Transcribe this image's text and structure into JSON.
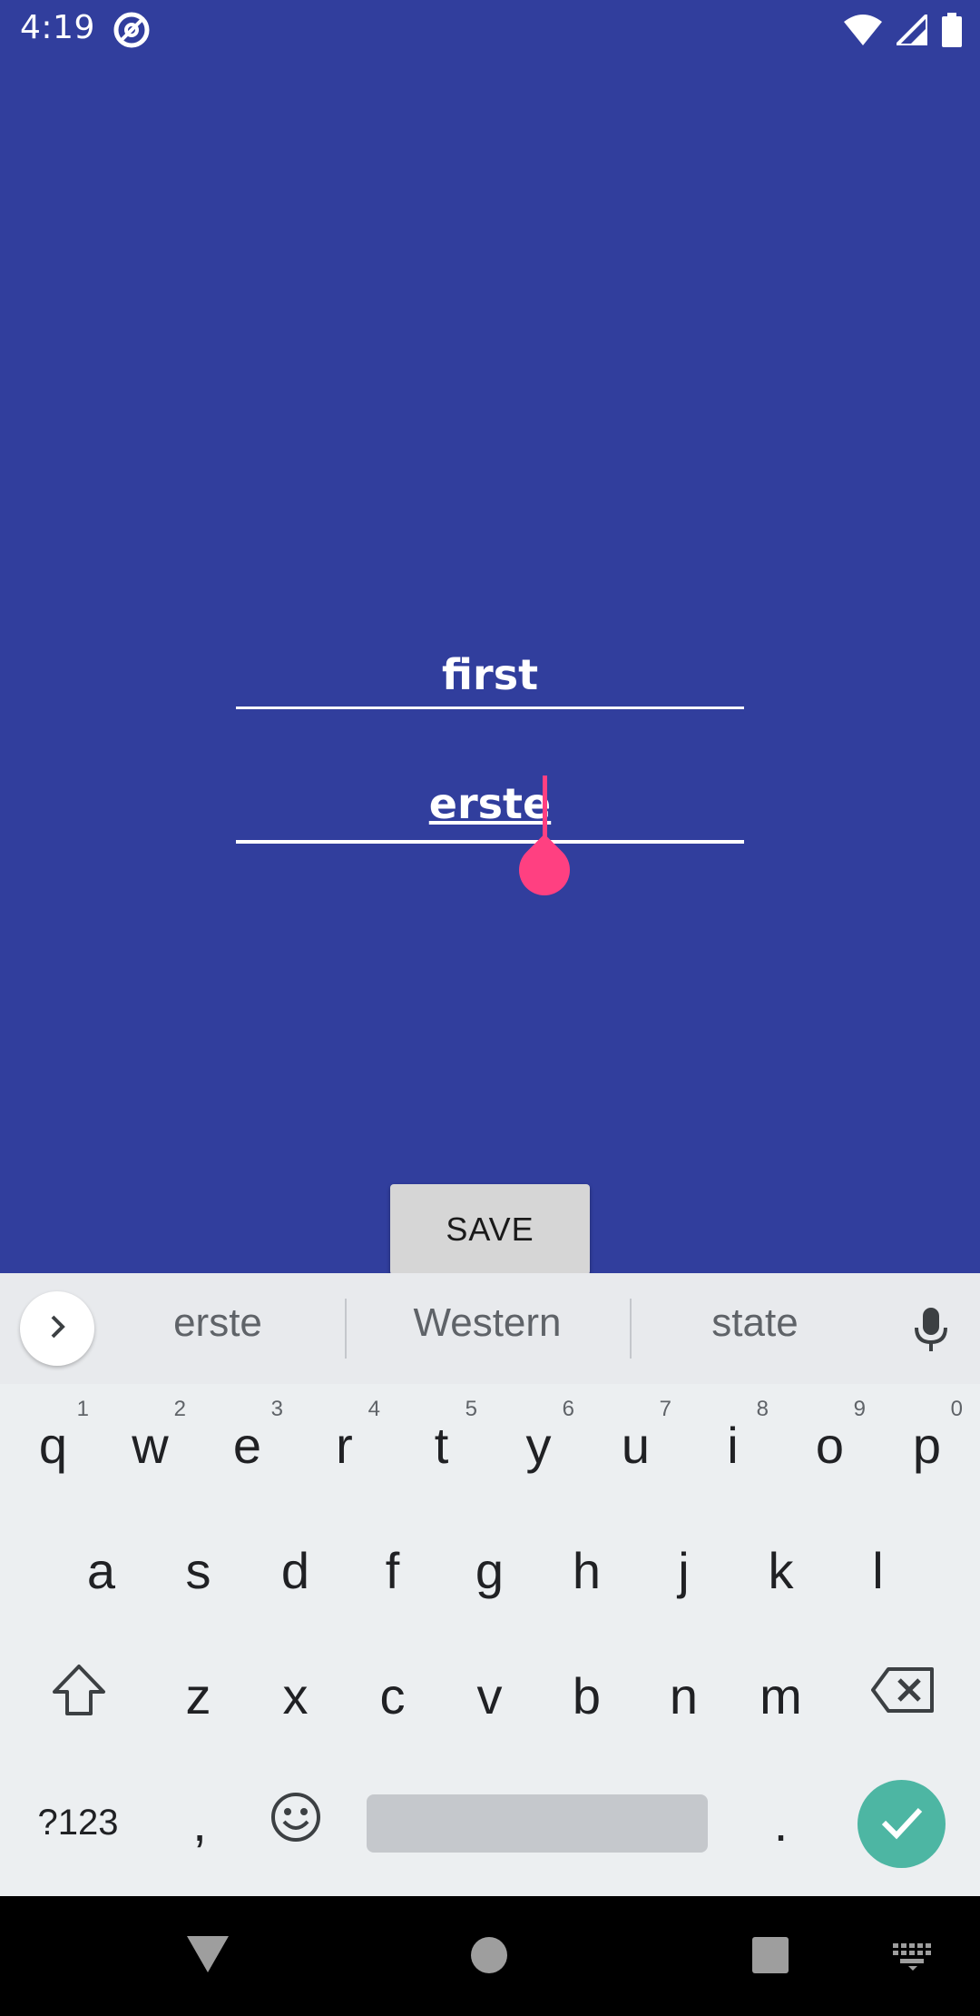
{
  "status": {
    "time": "4:19"
  },
  "form": {
    "field_first_value": "first",
    "field_second_value": "erste",
    "save_label": "SAVE"
  },
  "keyboard": {
    "suggestions": [
      "erste",
      "Western",
      "state"
    ],
    "row1": [
      {
        "key": "q",
        "hint": "1"
      },
      {
        "key": "w",
        "hint": "2"
      },
      {
        "key": "e",
        "hint": "3"
      },
      {
        "key": "r",
        "hint": "4"
      },
      {
        "key": "t",
        "hint": "5"
      },
      {
        "key": "y",
        "hint": "6"
      },
      {
        "key": "u",
        "hint": "7"
      },
      {
        "key": "i",
        "hint": "8"
      },
      {
        "key": "o",
        "hint": "9"
      },
      {
        "key": "p",
        "hint": "0"
      }
    ],
    "row2": [
      "a",
      "s",
      "d",
      "f",
      "g",
      "h",
      "j",
      "k",
      "l"
    ],
    "row3": [
      "z",
      "x",
      "c",
      "v",
      "b",
      "n",
      "m"
    ],
    "symbols_label": "?123",
    "comma": ",",
    "period": "."
  },
  "colors": {
    "app_background": "#313e9d",
    "accent": "#ff4081",
    "enter_key": "#4db6a3"
  }
}
